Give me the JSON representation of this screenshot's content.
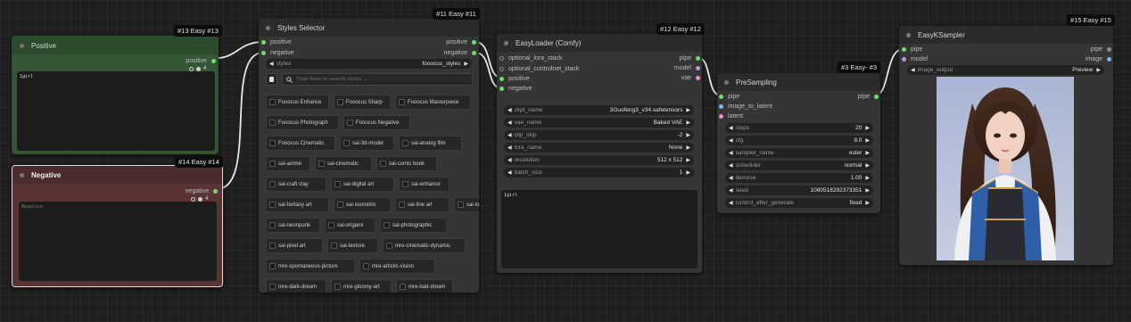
{
  "colors": {
    "canvas": "#1f1f1f",
    "node_body": "#353535",
    "node_title": "#2b2b2b",
    "positive_title": "#2c4a2c",
    "positive_body": "#345634",
    "negative_title": "#4a2c2c",
    "negative_body": "#5a3434",
    "wire": "#e6e6e6",
    "slot_green": "#6be06b",
    "slot_purple": "#b79ad9",
    "slot_blue": "#7db5e6",
    "slot_pink": "#ef8bd3"
  },
  "positive_node": {
    "badge": "#13 Easy #13",
    "title": "Positive",
    "output": "positive",
    "text": "1girl",
    "toggle_icons": [
      "circle-outline-icon",
      "circle-filled-icon"
    ],
    "toggle_count": "4"
  },
  "negative_node": {
    "badge": "#14 Easy #14",
    "title": "Negative",
    "output": "negative",
    "placeholder": "Negative",
    "toggle_icons": [
      "circle-outline-icon",
      "circle-filled-icon"
    ],
    "toggle_count": "4"
  },
  "styles_selector": {
    "badge": "#11 Easy #11",
    "title": "Styles Selector",
    "inputs": [
      "positive",
      "negative"
    ],
    "outputs": [
      "positive",
      "negative"
    ],
    "styles_widget": {
      "label": "styles",
      "value": "fooocus_styles"
    },
    "search_placeholder": "Type here to search styles ...",
    "buttons": [
      [
        "Fooocus Enhance",
        "Fooocus Sharp",
        "Fooocus Masterpiece"
      ],
      [
        "Fooocus Photograph",
        "Fooocus Negative"
      ],
      [
        "Fooocus Cinematic",
        "sai-3d-model",
        "sai-analog film"
      ],
      [
        "sai-anime",
        "sai-cinematic",
        "sai-comic book"
      ],
      [
        "sai-craft clay",
        "sai-digital art",
        "sai-enhance"
      ],
      [
        "sai-fantasy art",
        "sai-isometric",
        "sai-line art",
        "sai-lowpoly"
      ],
      [
        "sai-neonpunk",
        "sai-origami",
        "sai-photographic"
      ],
      [
        "sai-pixel art",
        "sai-texture",
        "mre-cinematic-dynamic"
      ],
      [
        "mre-spontaneous-picture",
        "mre-artistic-vision"
      ],
      [
        "mre-dark-dream",
        "mre-gloomy-art",
        "mre-bad-dream"
      ]
    ]
  },
  "easy_loader": {
    "badge": "#12 Easy #12",
    "title": "EasyLoader (Comfy)",
    "inputs": [
      "optional_lora_stack",
      "optional_controlnet_stack",
      "positive",
      "negative"
    ],
    "outputs": [
      "pipe",
      "model",
      "vae"
    ],
    "widgets": [
      {
        "label": "ckpt_name",
        "value": "3Guofeng3_v34.safetensors"
      },
      {
        "label": "vae_name",
        "value": "Baked VAE"
      },
      {
        "label": "clip_skip",
        "value": "-2"
      },
      {
        "label": "lora_name",
        "value": "None"
      },
      {
        "label": "resolution",
        "value": "512 x 512"
      },
      {
        "label": "batch_size",
        "value": "1"
      }
    ],
    "text": "1girl"
  },
  "presampling": {
    "badge": "#3 Easy- #3",
    "title": "PreSampling",
    "inputs": [
      "pipe",
      "image_to_latent",
      "latent"
    ],
    "outputs": [
      "pipe"
    ],
    "widgets": [
      {
        "label": "steps",
        "value": "20"
      },
      {
        "label": "cfg",
        "value": "8.0"
      },
      {
        "label": "sampler_name",
        "value": "euler"
      },
      {
        "label": "scheduler",
        "value": "normal"
      },
      {
        "label": "denoise",
        "value": "1.00"
      },
      {
        "label": "seed",
        "value": "1080518292373351"
      },
      {
        "label": "control_after_generate",
        "value": "fixed"
      }
    ]
  },
  "ksampler": {
    "badge": "#15 Easy #15",
    "title": "EasyKSampler",
    "inputs": [
      "pipe",
      "model"
    ],
    "outputs": [
      "pipe",
      "image"
    ],
    "widget": {
      "label": "image_output",
      "value": "Preview"
    }
  }
}
